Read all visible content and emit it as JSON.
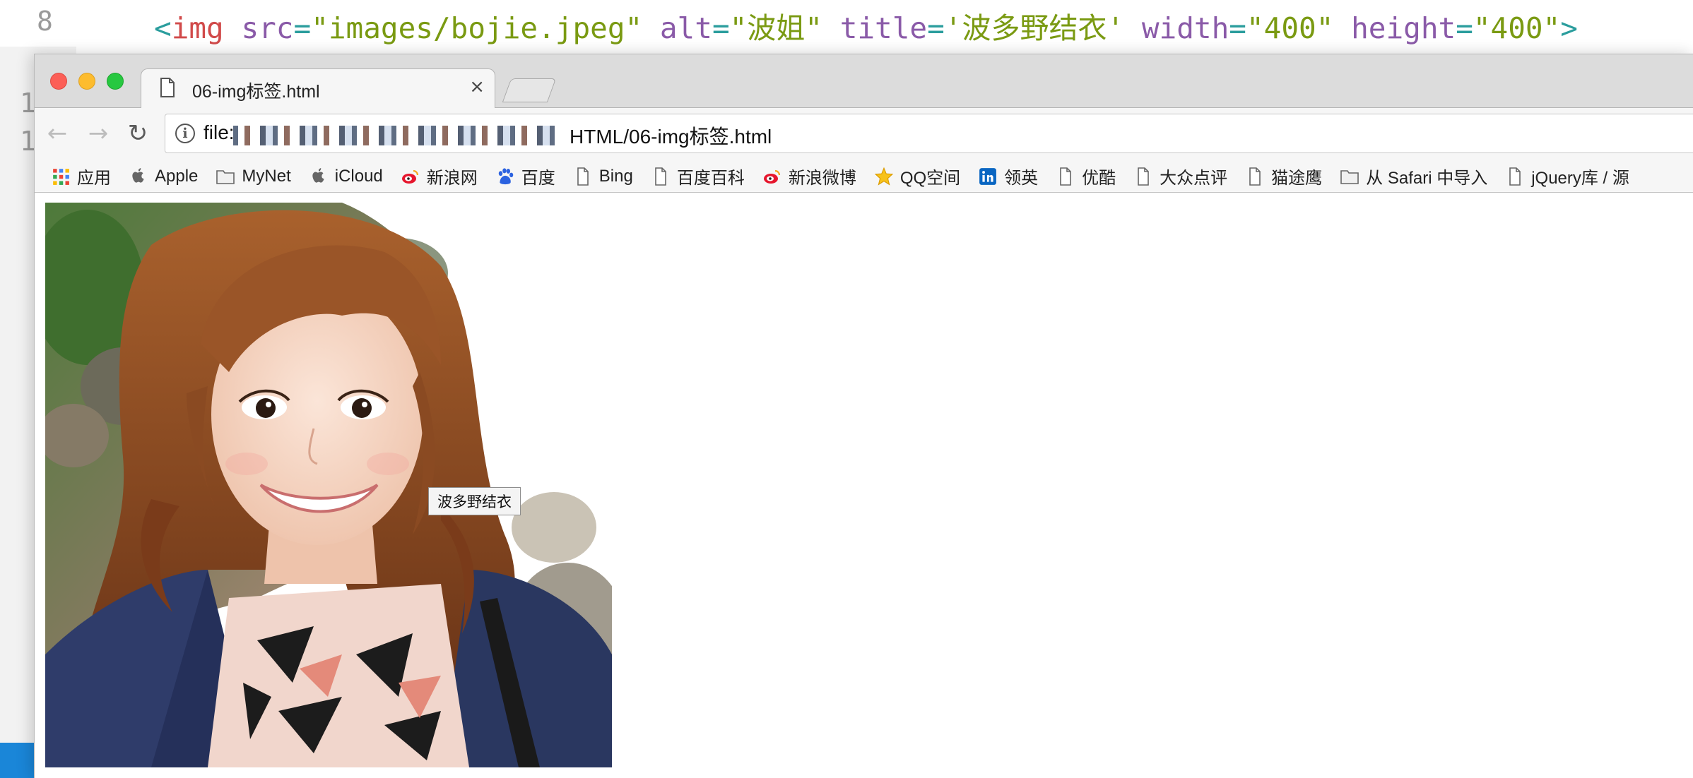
{
  "editor": {
    "line_number": "8",
    "gutter_partial": [
      "1",
      "1"
    ],
    "code": {
      "open": "<",
      "tag": "img",
      "attr_src": "src",
      "eq": "=",
      "val_src": "\"images/bojie.jpeg\"",
      "attr_alt": "alt",
      "val_alt": "\"波姐\"",
      "attr_title": "title",
      "val_title": "'波多野结衣'",
      "attr_width": "width",
      "val_width": "\"400\"",
      "attr_height": "height",
      "val_height": "\"400\"",
      "close": ">"
    }
  },
  "browser": {
    "tab": {
      "title": "06-img标签.html",
      "close_label": "×"
    },
    "nav": {
      "back": "←",
      "forward": "→",
      "reload": "↻"
    },
    "address": {
      "info_label": "i",
      "prefix": "file:",
      "suffix": "HTML/06-img标签.html"
    },
    "bookmarks": [
      {
        "label": "应用",
        "icon": "apps-grid-icon"
      },
      {
        "label": "Apple",
        "icon": "apple-icon"
      },
      {
        "label": "MyNet",
        "icon": "folder-icon"
      },
      {
        "label": "iCloud",
        "icon": "apple-icon"
      },
      {
        "label": "新浪网",
        "icon": "weibo-icon"
      },
      {
        "label": "百度",
        "icon": "baidu-paw-icon"
      },
      {
        "label": "Bing",
        "icon": "page-icon"
      },
      {
        "label": "百度百科",
        "icon": "page-icon"
      },
      {
        "label": "新浪微博",
        "icon": "weibo-icon"
      },
      {
        "label": "QQ空间",
        "icon": "star-icon"
      },
      {
        "label": "领英",
        "icon": "linkedin-icon"
      },
      {
        "label": "优酷",
        "icon": "page-icon"
      },
      {
        "label": "大众点评",
        "icon": "page-icon"
      },
      {
        "label": "猫途鹰",
        "icon": "page-icon"
      },
      {
        "label": "从 Safari 中导入",
        "icon": "folder-icon"
      },
      {
        "label": "jQuery库 / 源",
        "icon": "page-icon"
      }
    ],
    "page": {
      "image_alt": "波姐",
      "tooltip": "波多野结衣"
    }
  },
  "colors": {
    "traffic_red": "#fc5f57",
    "traffic_yellow": "#fdbc2e",
    "traffic_green": "#27c840",
    "code_tag": "#d14a4a",
    "code_attr": "#8a5aa8",
    "code_string": "#7a9a12",
    "code_punct": "#2a9d9d"
  }
}
